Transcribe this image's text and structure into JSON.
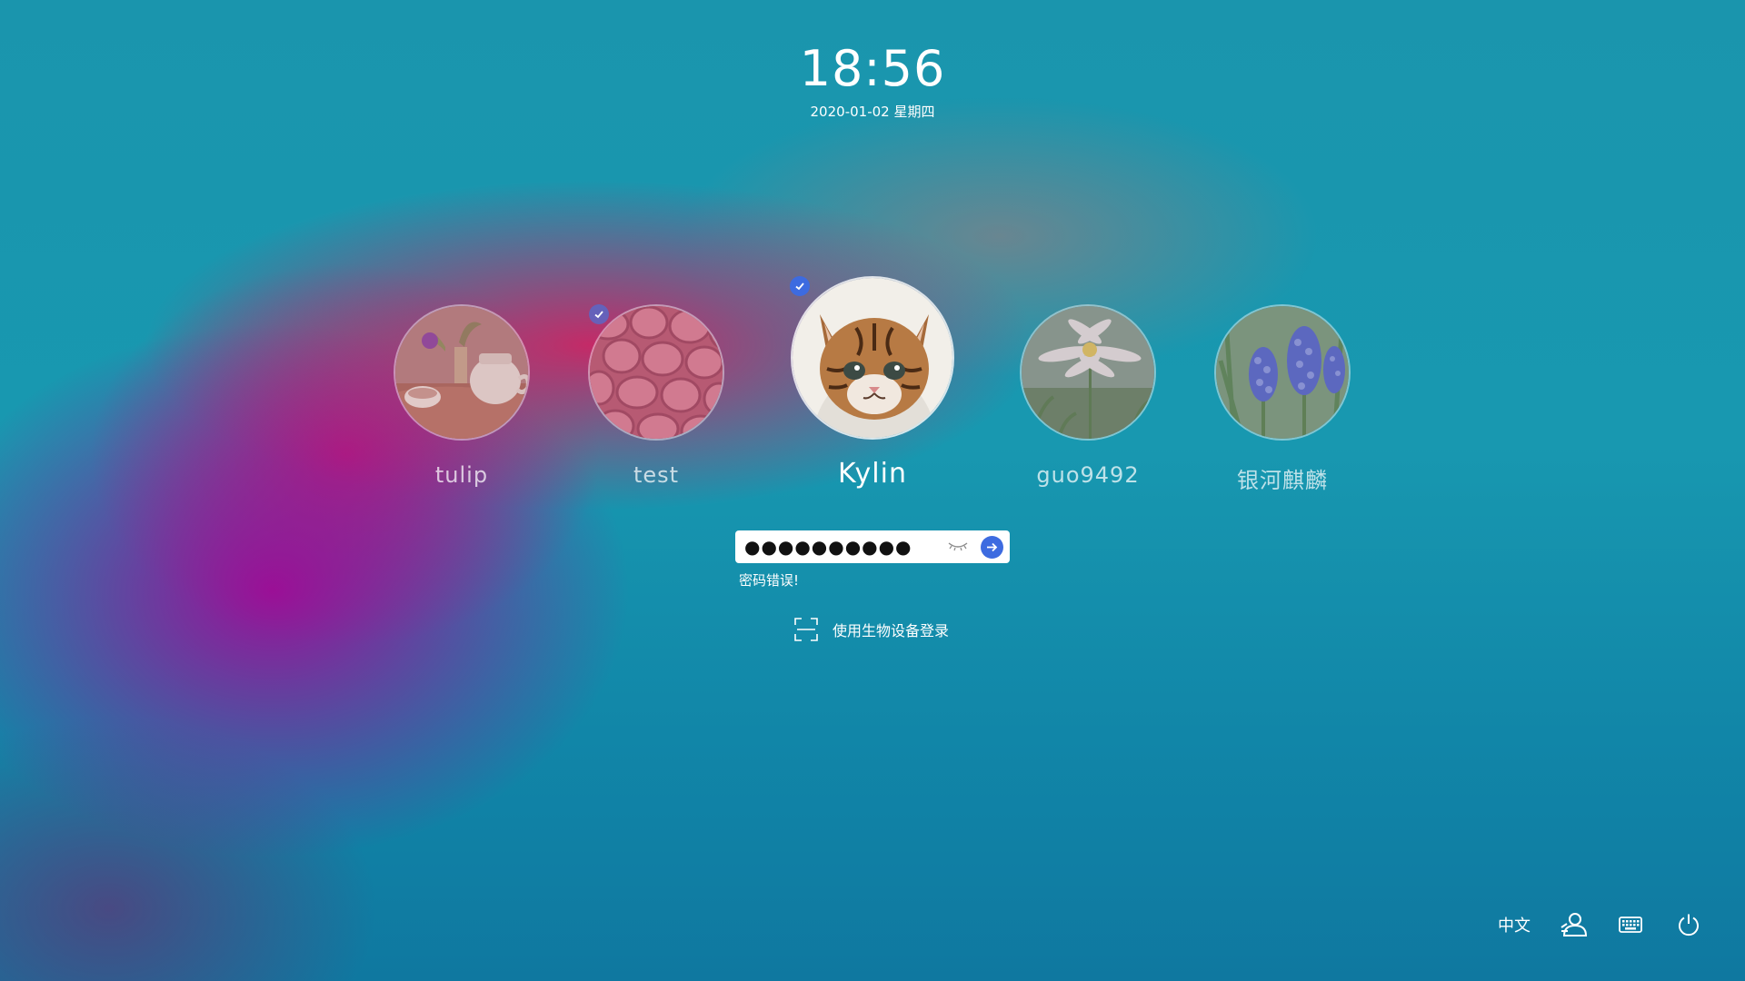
{
  "clock": {
    "time": "18:56",
    "date": "2020-01-02 星期四"
  },
  "users": [
    {
      "name": "tulip",
      "picture": "teapot-photo",
      "logged_in": false,
      "selected": false
    },
    {
      "name": "test",
      "picture": "pink-stones-photo",
      "logged_in": true,
      "selected": false
    },
    {
      "name": "Kylin",
      "picture": "kitten-photo",
      "logged_in": true,
      "selected": true
    },
    {
      "name": "guo9492",
      "picture": "daisy-photo",
      "logged_in": false,
      "selected": false
    },
    {
      "name": "银河麒麟",
      "picture": "grape-hyacinth-photo",
      "logged_in": false,
      "selected": false
    }
  ],
  "login": {
    "password_mask": "●●●●●●●●●●",
    "error": "密码错误!",
    "biometric_label": "使用生物设备登录"
  },
  "tray": {
    "language": "中文",
    "icons": [
      "switch-user-icon",
      "keyboard-icon",
      "power-icon"
    ]
  },
  "colors": {
    "accent": "#3d6be0",
    "text": "#ffffff"
  }
}
